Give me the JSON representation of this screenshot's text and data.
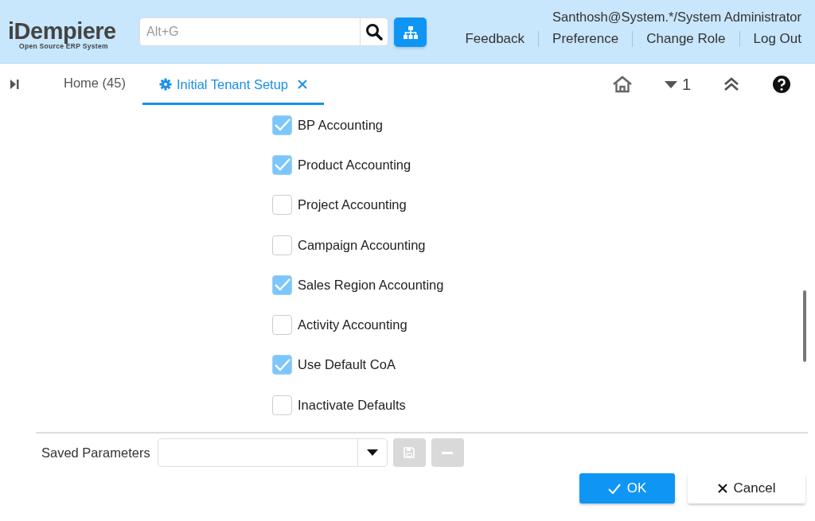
{
  "header": {
    "logo": {
      "name": "iDempiere",
      "tagline": "Open Source ERP System"
    },
    "search": {
      "placeholder": "Alt+G"
    },
    "user": "Santhosh@System.*/System Administrator",
    "links": [
      "Feedback",
      "Preference",
      "Change Role",
      "Log Out"
    ]
  },
  "tabs": [
    {
      "label": "Home (45)",
      "selected": false,
      "closable": false
    },
    {
      "label": "Initial Tenant Setup",
      "selected": true,
      "closable": true
    }
  ],
  "toolbar": {
    "count": "1"
  },
  "options": [
    {
      "label": "BP Accounting",
      "checked": true
    },
    {
      "label": "Product Accounting",
      "checked": true
    },
    {
      "label": "Project Accounting",
      "checked": false
    },
    {
      "label": "Campaign Accounting",
      "checked": false
    },
    {
      "label": "Sales Region Accounting",
      "checked": true
    },
    {
      "label": "Activity Accounting",
      "checked": false
    },
    {
      "label": "Use Default CoA",
      "checked": true
    },
    {
      "label": "Inactivate Defaults",
      "checked": false
    }
  ],
  "saved_parameters": {
    "label": "Saved Parameters",
    "save_disabled": true,
    "delete_disabled": true
  },
  "buttons": [
    {
      "kind": "ok",
      "label": "OK"
    },
    {
      "kind": "cancel",
      "label": "Cancel"
    }
  ]
}
